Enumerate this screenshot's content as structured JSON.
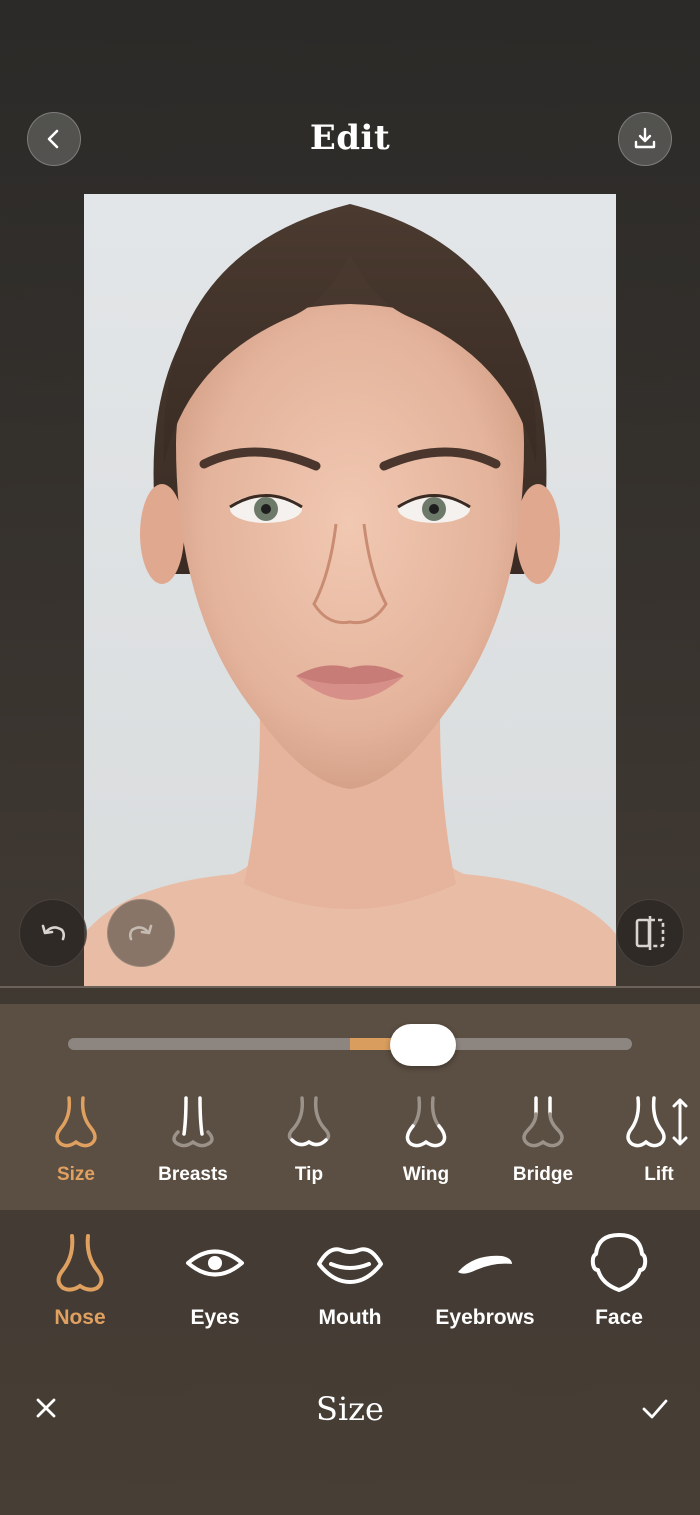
{
  "header": {
    "title": "Edit",
    "back_icon": "chevron-left-icon",
    "download_icon": "download-icon"
  },
  "photo": {
    "description_icon": "portrait-photo"
  },
  "controls": {
    "undo_icon": "undo-icon",
    "redo_icon": "redo-icon",
    "compare_icon": "compare-icon"
  },
  "slider": {
    "value": 0.63,
    "center": 0.5
  },
  "sub_tools": [
    {
      "label": "Size",
      "icon": "nose-size-icon",
      "active": true
    },
    {
      "label": "Breasts",
      "icon": "nose-breasts-icon",
      "active": false
    },
    {
      "label": "Tip",
      "icon": "nose-tip-icon",
      "active": false
    },
    {
      "label": "Wing",
      "icon": "nose-wing-icon",
      "active": false
    },
    {
      "label": "Bridge",
      "icon": "nose-bridge-icon",
      "active": false
    },
    {
      "label": "Lift",
      "icon": "nose-lift-icon",
      "active": false
    }
  ],
  "categories": [
    {
      "label": "Nose",
      "icon": "nose-icon",
      "active": true
    },
    {
      "label": "Eyes",
      "icon": "eye-icon",
      "active": false
    },
    {
      "label": "Mouth",
      "icon": "mouth-icon",
      "active": false
    },
    {
      "label": "Eyebrows",
      "icon": "eyebrow-icon",
      "active": false
    },
    {
      "label": "Face",
      "icon": "face-icon",
      "active": false
    }
  ],
  "footer": {
    "title": "Size",
    "cancel_icon": "close-icon",
    "confirm_icon": "check-icon"
  },
  "colors": {
    "accent": "#e0a060",
    "slider_fill": "#d99d5d",
    "panel": "#5b4e42"
  }
}
